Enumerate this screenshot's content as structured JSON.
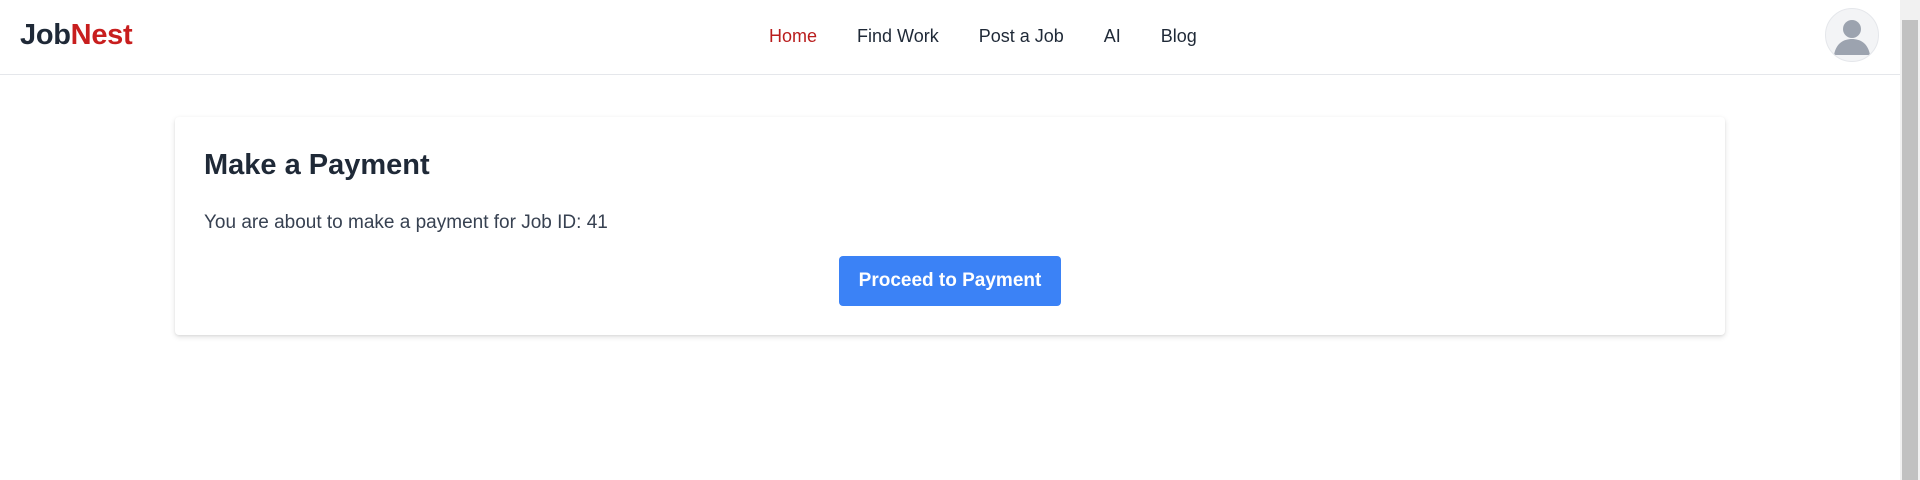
{
  "brand": {
    "name_part1": "Job",
    "name_part2": "Nest",
    "color_dark": "#1f2937",
    "color_accent": "#c81e1e"
  },
  "nav": {
    "items": [
      {
        "label": "Home",
        "active": true
      },
      {
        "label": "Find Work",
        "active": false
      },
      {
        "label": "Post a Job",
        "active": false
      },
      {
        "label": "AI",
        "active": false
      },
      {
        "label": "Blog",
        "active": false
      }
    ],
    "active_color": "#b91c1c"
  },
  "user": {
    "avatar_icon": "user-avatar-icon"
  },
  "payment": {
    "title": "Make a Payment",
    "message": "You are about to make a payment for Job ID: 41",
    "button_label": "Proceed to Payment",
    "button_color": "#3b82f6"
  }
}
